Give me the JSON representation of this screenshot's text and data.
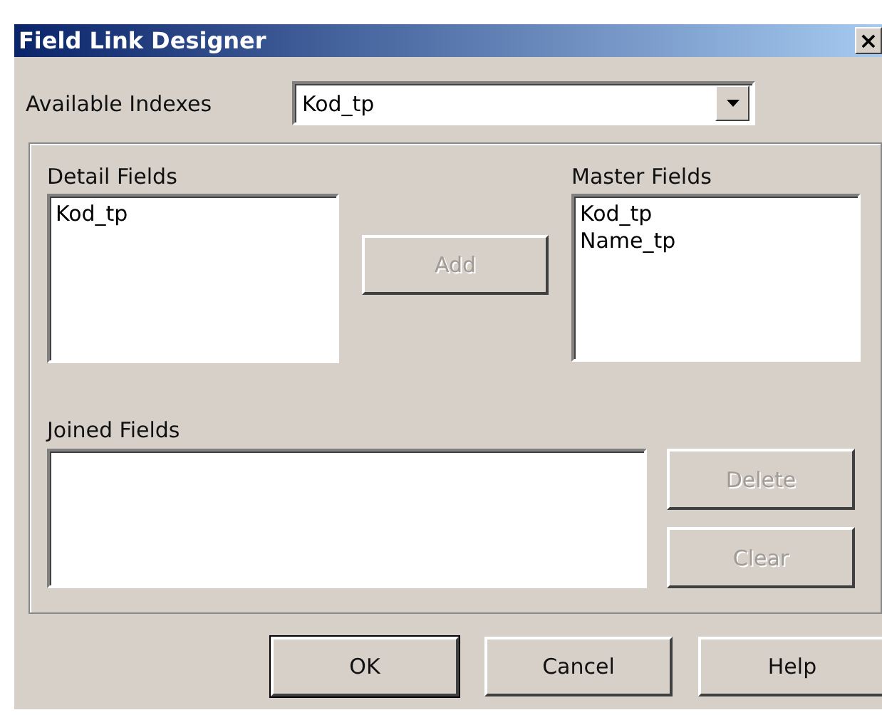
{
  "window": {
    "title": "Field Link Designer",
    "close": "×"
  },
  "indexes": {
    "label": "Available Indexes",
    "value": "Kod_tp"
  },
  "detail_fields": {
    "label": "Detail Fields",
    "items": [
      {
        "text": "Kod_tp",
        "selected": false
      }
    ]
  },
  "add_button": {
    "label": "Add",
    "disabled": true
  },
  "master_fields": {
    "label": "Master Fields",
    "items": [
      {
        "text": "Kod_tp",
        "selected": false
      },
      {
        "text": "Name_tp",
        "selected": false
      }
    ]
  },
  "joined_fields": {
    "label": "Joined Fields"
  },
  "side_buttons": [
    {
      "label": "Delete",
      "disabled": true
    },
    {
      "label": "Clear",
      "disabled": true
    }
  ],
  "buttons": [
    {
      "label": "OK",
      "disabled": false,
      "default": true
    },
    {
      "label": "Cancel",
      "disabled": false,
      "default": false
    },
    {
      "label": "Help",
      "disabled": false,
      "default": false
    }
  ]
}
